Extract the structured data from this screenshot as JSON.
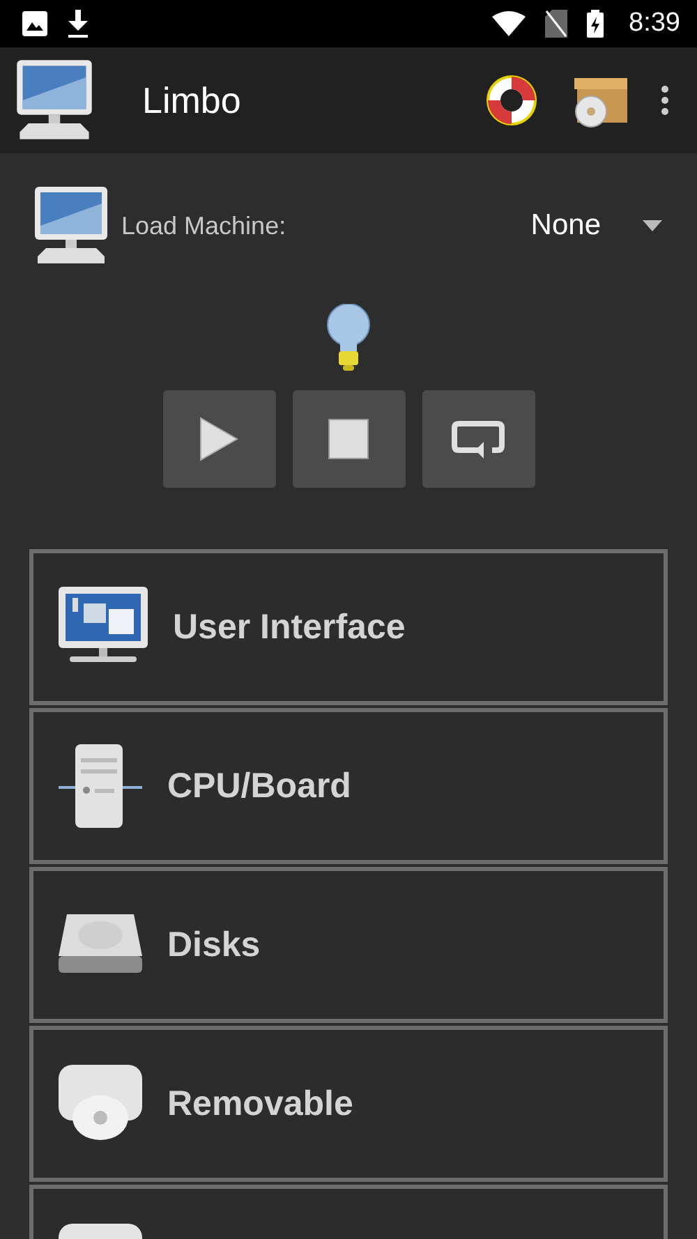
{
  "status_bar": {
    "time": "8:39"
  },
  "app_bar": {
    "title": "Limbo"
  },
  "load_machine": {
    "label": "Load Machine:",
    "value": "None"
  },
  "controls": [
    {
      "kind": "play"
    },
    {
      "kind": "stop"
    },
    {
      "kind": "restart"
    }
  ],
  "sections": [
    {
      "kind": "monitor",
      "label": "User Interface"
    },
    {
      "kind": "tower",
      "label": "CPU/Board"
    },
    {
      "kind": "disk",
      "label": "Disks"
    },
    {
      "kind": "removable",
      "label": "Removable"
    },
    {
      "kind": "drive"
    }
  ]
}
